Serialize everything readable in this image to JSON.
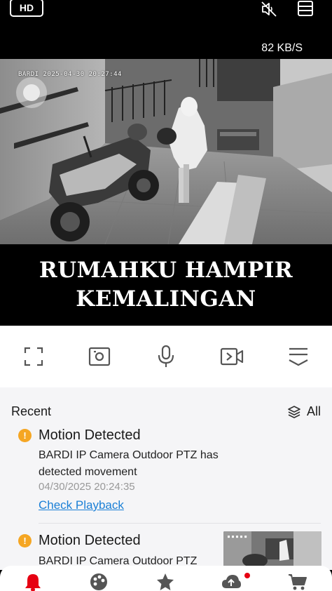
{
  "top_bar": {
    "quality_badge": "HD",
    "speed": "82 KB/S"
  },
  "video": {
    "osd_text": "BARDI 2025-04-30 20:27:44"
  },
  "caption": {
    "line1": "RUMAHKU HAMPIR",
    "line2": "KEMALINGAN"
  },
  "recent": {
    "title": "Recent",
    "all_label": "All",
    "events": [
      {
        "title": "Motion Detected",
        "description": "BARDI IP Camera Outdoor PTZ has detected movement",
        "time": "04/30/2025 20:24:35",
        "link": "Check Playback"
      },
      {
        "title": "Motion Detected",
        "description": "BARDI IP Camera Outdoor PTZ"
      }
    ]
  },
  "colors": {
    "accent_red": "#e60012",
    "warning": "#f5a623",
    "link": "#1a7fd6"
  }
}
